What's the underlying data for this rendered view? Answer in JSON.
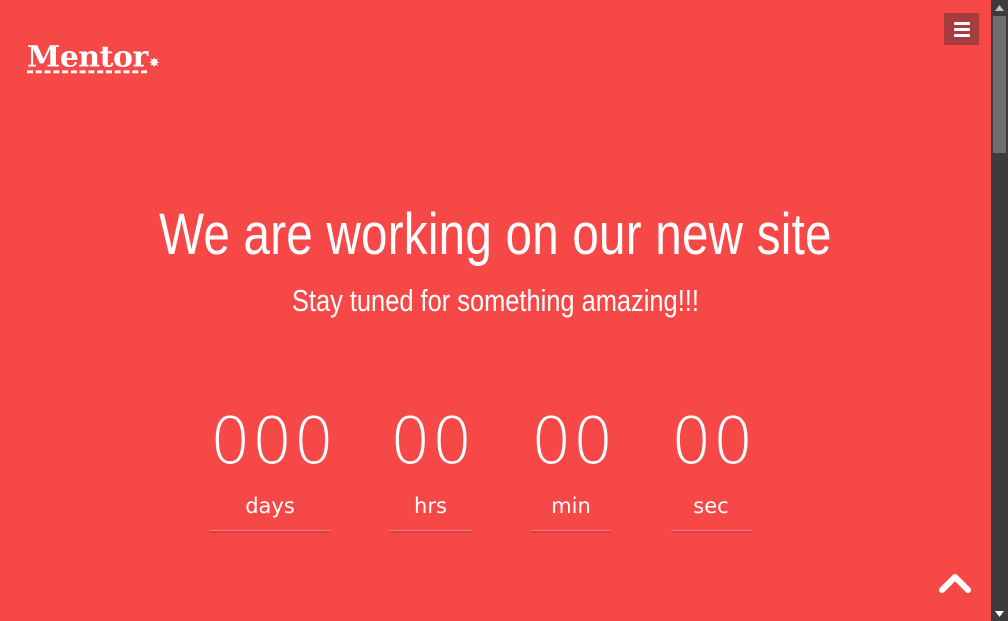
{
  "header": {
    "logo": {
      "text": "Mentor",
      "mark": "✸",
      "icon": "sparkle-icon"
    },
    "menu_toggle": {
      "icon": "hamburger-menu-icon"
    }
  },
  "hero": {
    "title": "We are working on our new site",
    "subtitle": "Stay tuned for something amazing!!!"
  },
  "countdown": {
    "units": [
      {
        "value": "000",
        "label": "days"
      },
      {
        "value": "00",
        "label": "hrs"
      },
      {
        "value": "00",
        "label": "min"
      },
      {
        "value": "00",
        "label": "sec"
      }
    ]
  },
  "scroll_top": {
    "icon": "chevron-up-icon"
  },
  "colors": {
    "background": "#f74848",
    "text": "#ffffff",
    "menu_button": "#a83b3d",
    "divider": "#d63d3f",
    "scrollbar_track": "#3c3c3c",
    "scrollbar_thumb": "#6e6e6e"
  }
}
